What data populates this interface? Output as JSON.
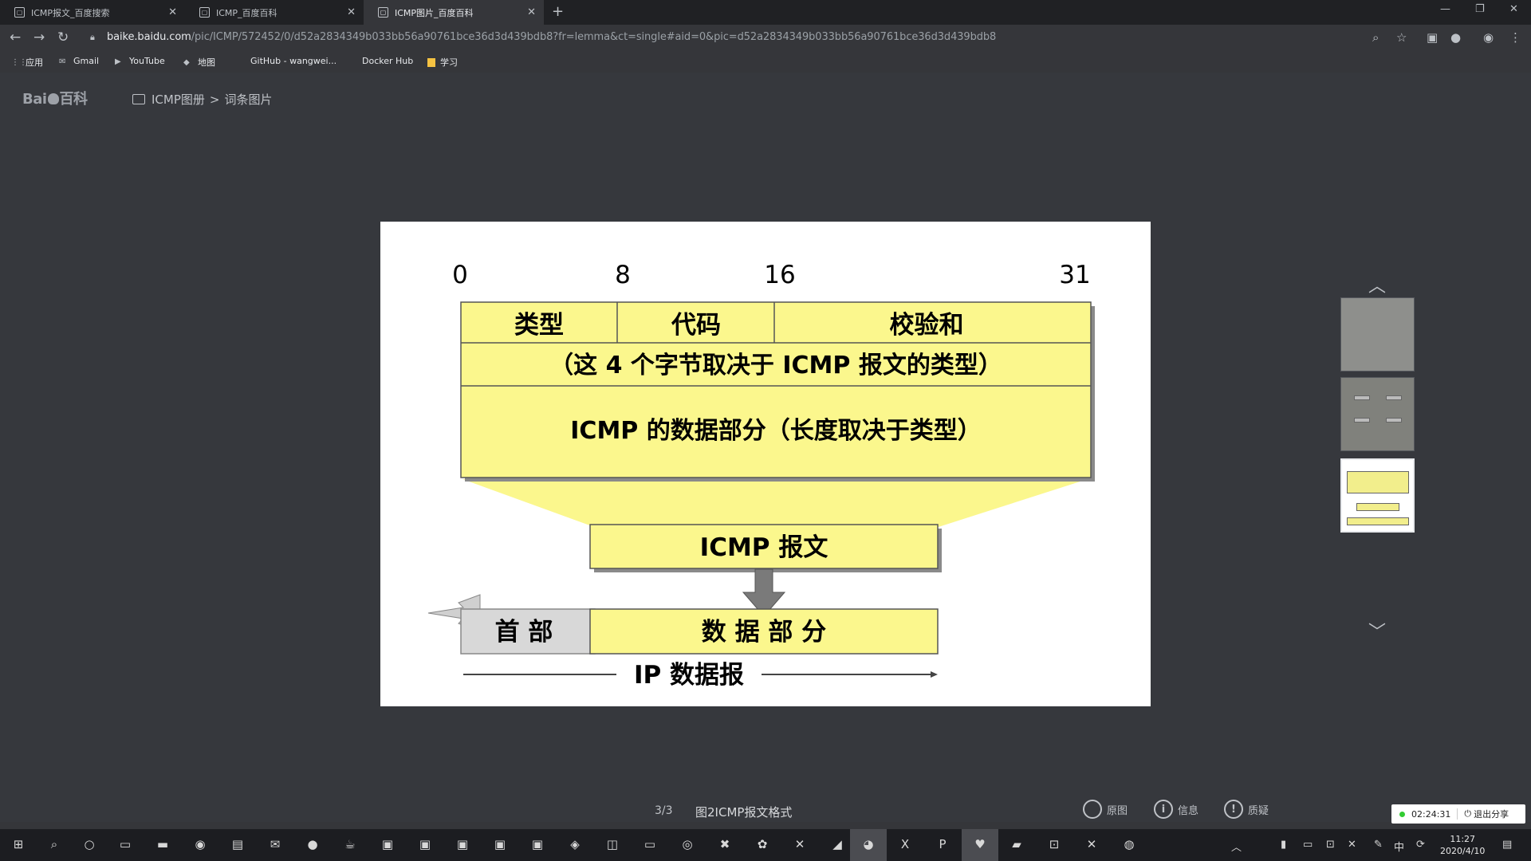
{
  "browser": {
    "tabs": [
      {
        "title": "ICMP报文_百度搜索",
        "active": false
      },
      {
        "title": "ICMP_百度百科",
        "active": false
      },
      {
        "title": "ICMP图片_百度百科",
        "active": true
      }
    ],
    "url_host": "baike.baidu.com",
    "url_path": "/pic/ICMP/572452/0/d52a2834349b033bb56a90761bce36d3d439bdb8?fr=lemma&ct=single#aid=0&pic=d52a2834349b033bb56a90761bce36d3d439bdb8",
    "bookmarks": [
      {
        "label": "应用",
        "icon": "apps-grid-icon"
      },
      {
        "label": "Gmail",
        "icon": "gmail-icon"
      },
      {
        "label": "YouTube",
        "icon": "youtube-icon"
      },
      {
        "label": "地图",
        "icon": "maps-icon"
      },
      {
        "label": "GitHub - wangwei...",
        "icon": "github-icon"
      },
      {
        "label": "Docker Hub",
        "icon": "docker-icon"
      },
      {
        "label": "学习",
        "icon": "folder-icon"
      }
    ]
  },
  "header": {
    "logo_prefix": "Bai",
    "logo_suffix": "百科",
    "album": "ICMP图册",
    "separator": ">",
    "section": "词条图片"
  },
  "diagram": {
    "bit_labels": [
      "0",
      "8",
      "16",
      "31"
    ],
    "field_type": "类型",
    "field_code": "代码",
    "field_checksum": "校验和",
    "row2": "（这 4 个字节取决于 ICMP 报文的类型）",
    "row3": "ICMP 的数据部分（长度取决于类型）",
    "icmp_message": "ICMP 报文",
    "ip_header": "首 部",
    "ip_data": "数 据 部 分",
    "ip_datagram": "IP 数据报",
    "fill_color": "#fbf78d"
  },
  "viewer": {
    "counter": "3/3",
    "caption": "图2ICMP报文格式",
    "actions": [
      {
        "label": "原图",
        "icon": "magnifier-icon"
      },
      {
        "label": "信息",
        "icon": "info-icon"
      },
      {
        "label": "质疑",
        "icon": "alert-icon"
      }
    ]
  },
  "recording": {
    "time": "02:24:31",
    "exit_label": "退出分享"
  },
  "taskbar": {
    "ime": "中",
    "time": "11:27",
    "date": "2020/4/10"
  }
}
